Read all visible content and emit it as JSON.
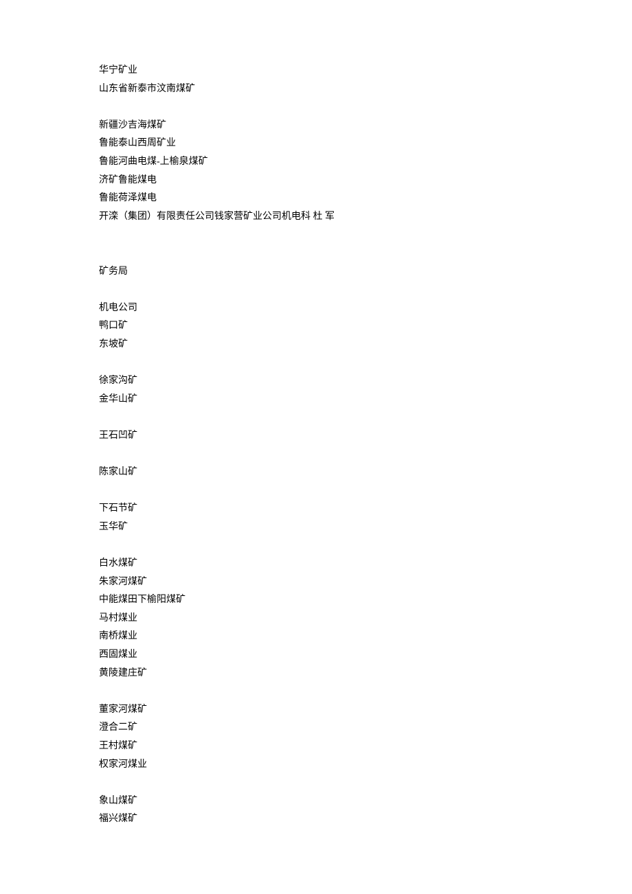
{
  "lines": [
    {
      "type": "text",
      "value": "华宁矿业"
    },
    {
      "type": "text",
      "value": "山东省新泰市汶南煤矿"
    },
    {
      "type": "blank"
    },
    {
      "type": "text",
      "value": "新疆沙吉海煤矿"
    },
    {
      "type": "text",
      "value": "鲁能泰山西周矿业"
    },
    {
      "type": "text",
      "value": "鲁能河曲电煤-上榆泉煤矿"
    },
    {
      "type": "text",
      "value": "济矿鲁能煤电"
    },
    {
      "type": "text",
      "value": "鲁能荷泽煤电"
    },
    {
      "type": "text",
      "value": "开滦（集团）有限责任公司钱家营矿业公司机电科 杜 军"
    },
    {
      "type": "blank"
    },
    {
      "type": "blank"
    },
    {
      "type": "text",
      "value": "矿务局"
    },
    {
      "type": "blank"
    },
    {
      "type": "text",
      "value": "机电公司"
    },
    {
      "type": "text",
      "value": "鸭口矿"
    },
    {
      "type": "text",
      "value": "东坡矿"
    },
    {
      "type": "blank"
    },
    {
      "type": "text",
      "value": "徐家沟矿"
    },
    {
      "type": "text",
      "value": "金华山矿"
    },
    {
      "type": "blank"
    },
    {
      "type": "text",
      "value": "王石凹矿"
    },
    {
      "type": "blank"
    },
    {
      "type": "text",
      "value": "陈家山矿"
    },
    {
      "type": "blank"
    },
    {
      "type": "text",
      "value": "下石节矿"
    },
    {
      "type": "text",
      "value": "玉华矿"
    },
    {
      "type": "blank"
    },
    {
      "type": "text",
      "value": "白水煤矿"
    },
    {
      "type": "text",
      "value": "朱家河煤矿"
    },
    {
      "type": "text",
      "value": "中能煤田下榆阳煤矿"
    },
    {
      "type": "text",
      "value": "马村煤业"
    },
    {
      "type": "text",
      "value": "南桥煤业"
    },
    {
      "type": "text",
      "value": "西固煤业"
    },
    {
      "type": "text",
      "value": "黄陵建庄矿"
    },
    {
      "type": "blank"
    },
    {
      "type": "text",
      "value": "董家河煤矿"
    },
    {
      "type": "text",
      "value": "澄合二矿"
    },
    {
      "type": "text",
      "value": "王村煤矿"
    },
    {
      "type": "text",
      "value": "权家河煤业"
    },
    {
      "type": "blank"
    },
    {
      "type": "text",
      "value": "象山煤矿"
    },
    {
      "type": "text",
      "value": "福兴煤矿"
    }
  ]
}
